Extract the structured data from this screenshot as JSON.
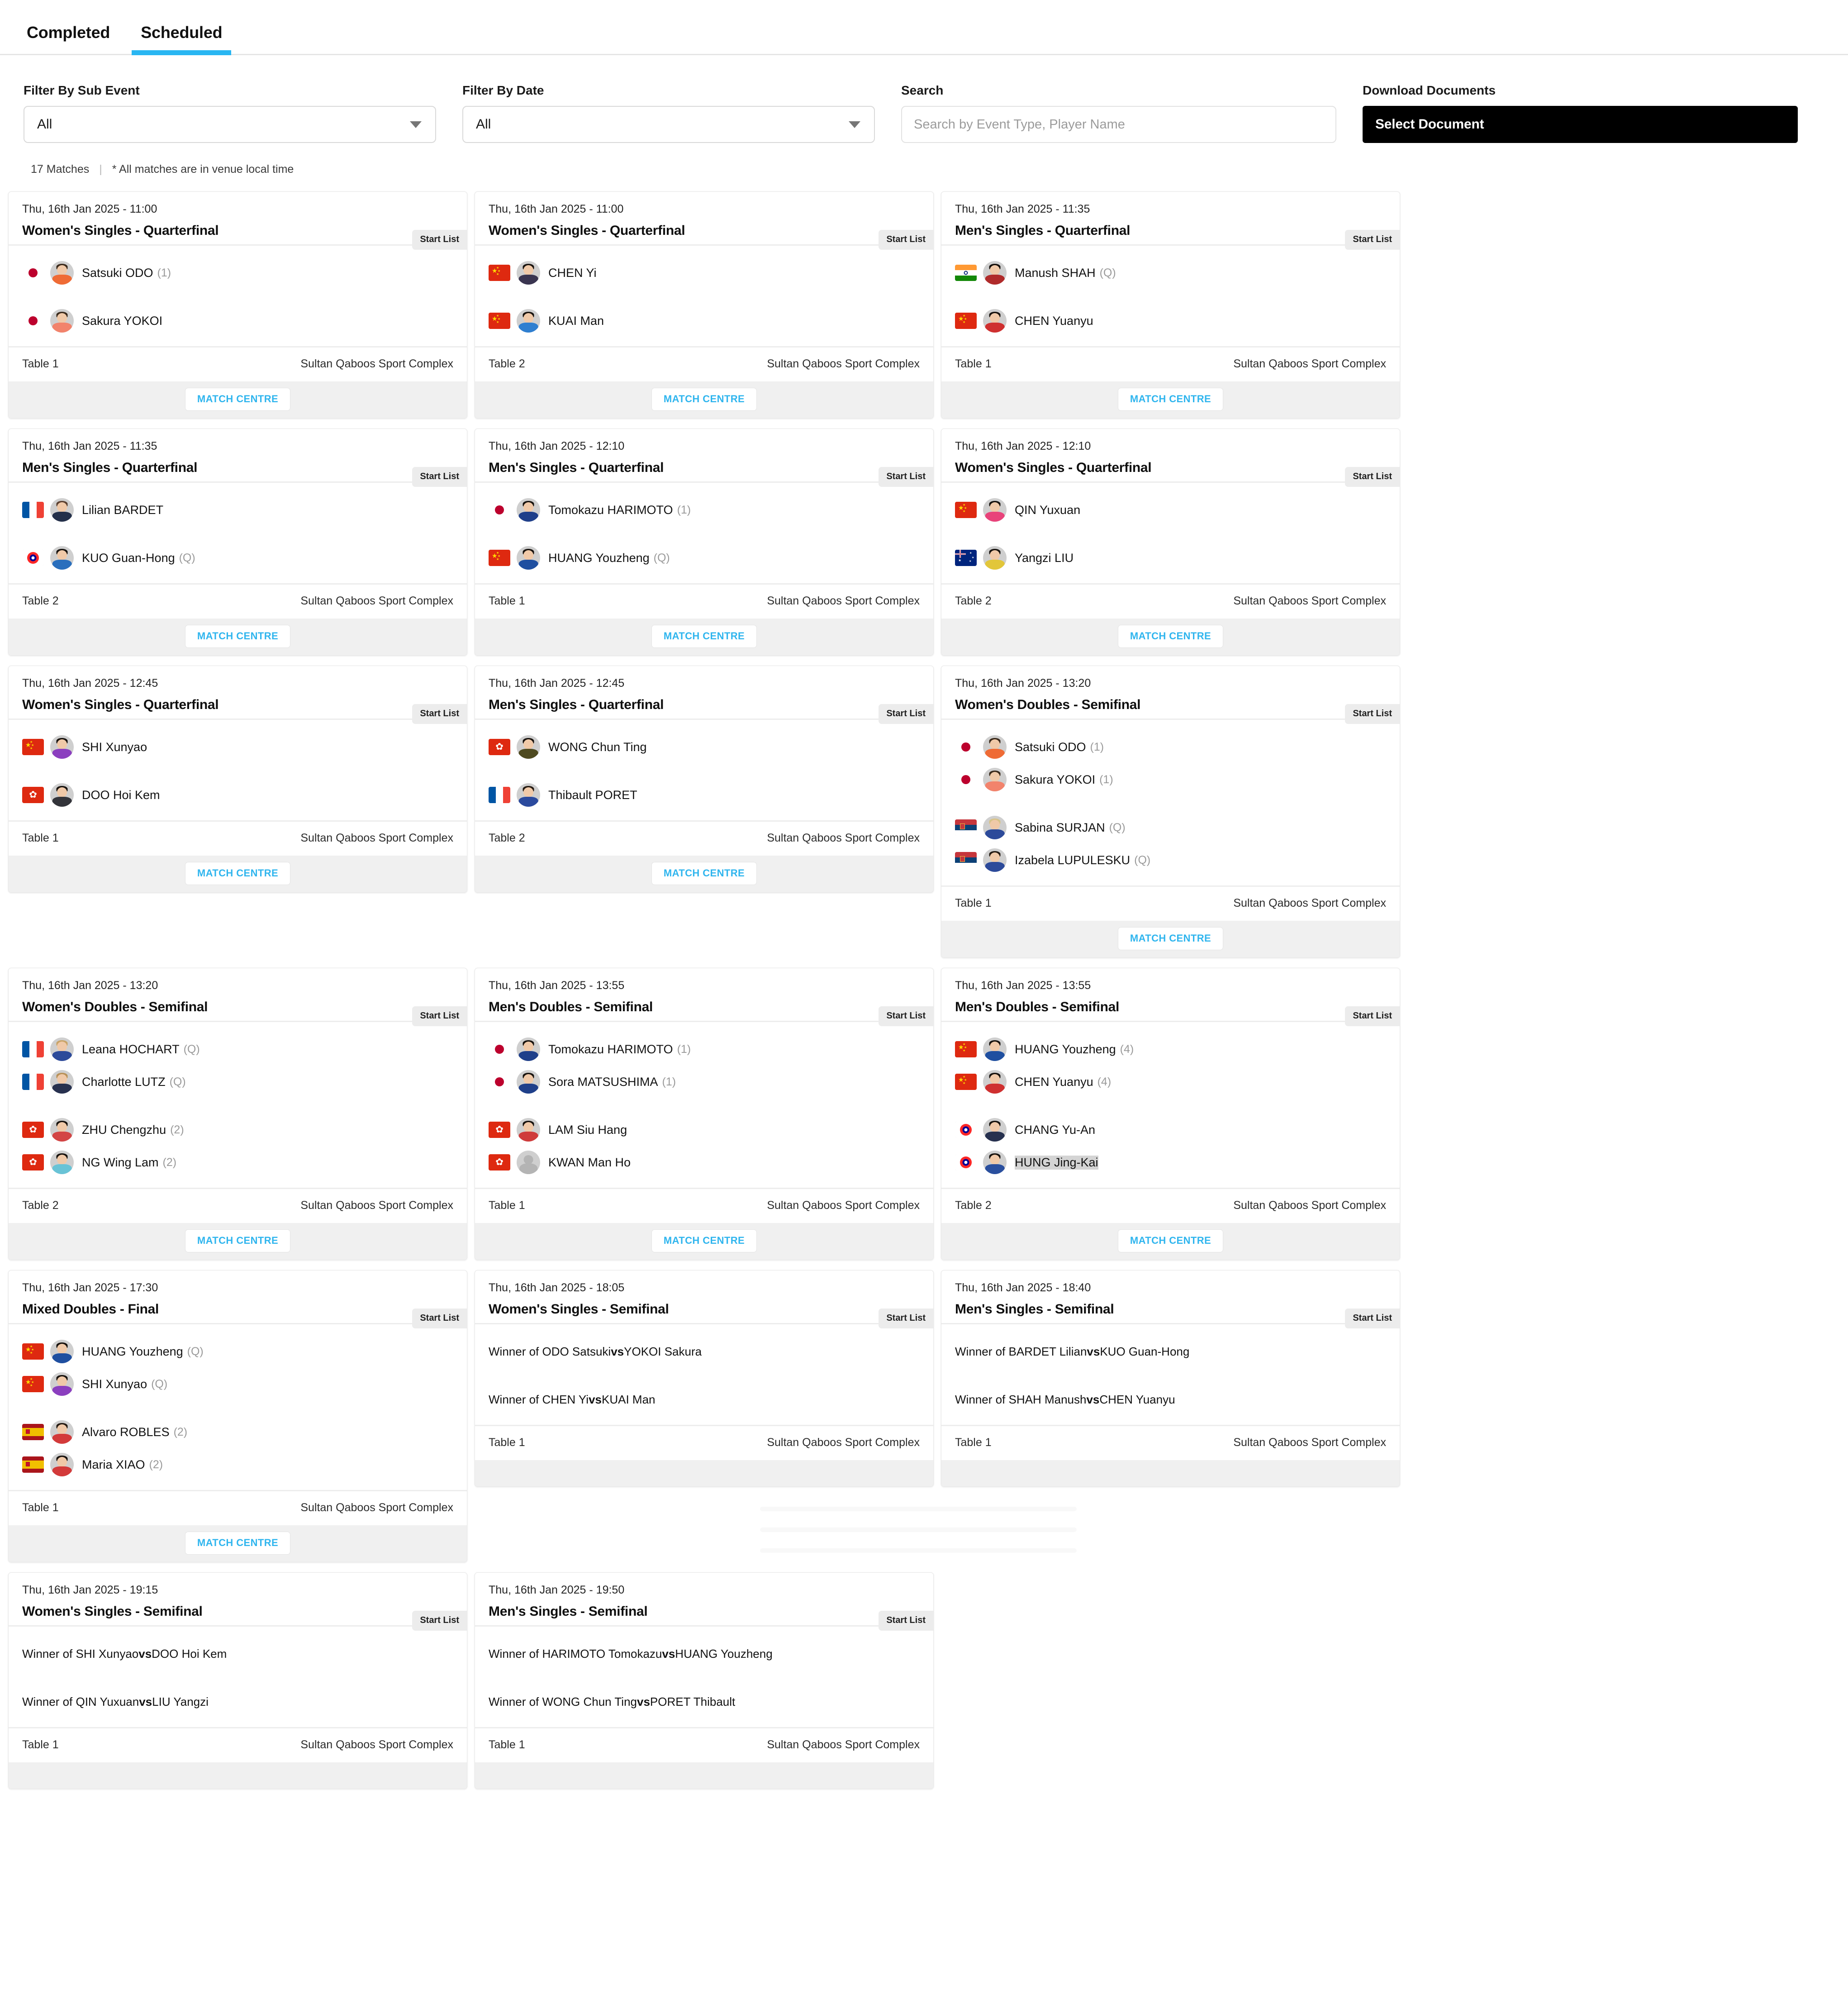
{
  "tabs": [
    {
      "label": "Completed",
      "active": false
    },
    {
      "label": "Scheduled",
      "active": true
    }
  ],
  "filters": {
    "sub_event": {
      "label": "Filter By Sub Event",
      "value": "All"
    },
    "date": {
      "label": "Filter By Date",
      "value": "All"
    },
    "search": {
      "label": "Search",
      "placeholder": "Search by Event Type, Player Name",
      "value": ""
    },
    "documents": {
      "label": "Download Documents",
      "button": "Select Document"
    }
  },
  "summary": {
    "count": "17 Matches",
    "separator": "|",
    "note": "* All matches are in venue local time"
  },
  "labels": {
    "start_list": "Start List",
    "match_centre": "MATCH CENTRE",
    "venue": "Sultan Qaboos Sport Complex"
  },
  "colors": {
    "accent": "#29b6f2",
    "match_centre_text": "#2fb5ee",
    "doc_button_bg": "#000000",
    "selection_highlight": "#d4d4d4"
  },
  "matches": [
    {
      "date": "Thu, 16th Jan 2025 - 11:00",
      "title": "Women's Singles - Quarterfinal",
      "table": "Table 1",
      "venue": "Sultan Qaboos Sport Complex",
      "has_match_centre": true,
      "teams": [
        {
          "players": [
            {
              "name": "Satsuki ODO",
              "seed": "(1)",
              "flag": "jp",
              "shirt": "#ef6b35",
              "hair": "#3a2a1c"
            }
          ]
        },
        {
          "players": [
            {
              "name": "Sakura YOKOI",
              "seed": "",
              "flag": "jp",
              "shirt": "#f2836c",
              "hair": "#3a2a1c"
            }
          ]
        }
      ]
    },
    {
      "date": "Thu, 16th Jan 2025 - 11:00",
      "title": "Women's Singles - Quarterfinal",
      "table": "Table 2",
      "venue": "Sultan Qaboos Sport Complex",
      "has_match_centre": true,
      "teams": [
        {
          "players": [
            {
              "name": "CHEN Yi",
              "seed": "",
              "flag": "cn",
              "shirt": "#3a3550",
              "hair": "#17120e"
            }
          ]
        },
        {
          "players": [
            {
              "name": "KUAI Man",
              "seed": "",
              "flag": "cn",
              "shirt": "#2f7fd0",
              "hair": "#17120e"
            }
          ]
        }
      ]
    },
    {
      "date": "Thu, 16th Jan 2025 - 11:35",
      "title": "Men's Singles - Quarterfinal",
      "table": "Table 1",
      "venue": "Sultan Qaboos Sport Complex",
      "has_match_centre": true,
      "teams": [
        {
          "players": [
            {
              "name": "Manush SHAH",
              "seed": "(Q)",
              "flag": "in",
              "shirt": "#b02b2b",
              "hair": "#140f0b"
            }
          ]
        },
        {
          "players": [
            {
              "name": "CHEN Yuanyu",
              "seed": "",
              "flag": "cn",
              "shirt": "#cf3030",
              "hair": "#17120e"
            }
          ]
        }
      ]
    },
    {
      "date": "Thu, 16th Jan 2025 - 11:35",
      "title": "Men's Singles - Quarterfinal",
      "table": "Table 2",
      "venue": "Sultan Qaboos Sport Complex",
      "has_match_centre": true,
      "teams": [
        {
          "players": [
            {
              "name": "Lilian BARDET",
              "seed": "",
              "flag": "fr",
              "shirt": "#24304a",
              "hair": "#5b4030"
            }
          ]
        },
        {
          "players": [
            {
              "name": "KUO Guan-Hong",
              "seed": "(Q)",
              "flag": "tw",
              "shirt": "#2a6fbd",
              "hair": "#17120e"
            }
          ]
        }
      ]
    },
    {
      "date": "Thu, 16th Jan 2025 - 12:10",
      "title": "Men's Singles - Quarterfinal",
      "table": "Table 1",
      "venue": "Sultan Qaboos Sport Complex",
      "has_match_centre": true,
      "teams": [
        {
          "players": [
            {
              "name": "Tomokazu HARIMOTO",
              "seed": "(1)",
              "flag": "jp",
              "shirt": "#1f3f8a",
              "hair": "#17120e"
            }
          ]
        },
        {
          "players": [
            {
              "name": "HUANG Youzheng",
              "seed": "(Q)",
              "flag": "cn",
              "shirt": "#1f4fa0",
              "hair": "#17120e"
            }
          ]
        }
      ]
    },
    {
      "date": "Thu, 16th Jan 2025 - 12:10",
      "title": "Women's Singles - Quarterfinal",
      "table": "Table 2",
      "venue": "Sultan Qaboos Sport Complex",
      "has_match_centre": true,
      "teams": [
        {
          "players": [
            {
              "name": "QIN Yuxuan",
              "seed": "",
              "flag": "cn",
              "shirt": "#e8437a",
              "hair": "#17120e"
            }
          ]
        },
        {
          "players": [
            {
              "name": "Yangzi LIU",
              "seed": "",
              "flag": "au",
              "shirt": "#e2c63a",
              "hair": "#17120e"
            }
          ]
        }
      ]
    },
    {
      "date": "Thu, 16th Jan 2025 - 12:45",
      "title": "Women's Singles - Quarterfinal",
      "table": "Table 1",
      "venue": "Sultan Qaboos Sport Complex",
      "has_match_centre": true,
      "teams": [
        {
          "players": [
            {
              "name": "SHI Xunyao",
              "seed": "",
              "flag": "cn",
              "shirt": "#8b3fbf",
              "hair": "#17120e"
            }
          ]
        },
        {
          "players": [
            {
              "name": "DOO Hoi Kem",
              "seed": "",
              "flag": "hk",
              "shirt": "#33343a",
              "hair": "#17120e"
            }
          ]
        }
      ]
    },
    {
      "date": "Thu, 16th Jan 2025 - 12:45",
      "title": "Men's Singles - Quarterfinal",
      "table": "Table 2",
      "venue": "Sultan Qaboos Sport Complex",
      "has_match_centre": true,
      "teams": [
        {
          "players": [
            {
              "name": "WONG Chun Ting",
              "seed": "",
              "flag": "hk",
              "shirt": "#4e4a20",
              "hair": "#17120e"
            }
          ]
        },
        {
          "players": [
            {
              "name": "Thibault PORET",
              "seed": "",
              "flag": "fr",
              "shirt": "#2b4a9e",
              "hair": "#241a12"
            }
          ]
        }
      ]
    },
    {
      "date": "Thu, 16th Jan 2025 - 13:20",
      "title": "Women's Doubles - Semifinal",
      "table": "Table 1",
      "venue": "Sultan Qaboos Sport Complex",
      "has_match_centre": true,
      "teams": [
        {
          "players": [
            {
              "name": "Satsuki ODO",
              "seed": "(1)",
              "flag": "jp",
              "shirt": "#ef6b35",
              "hair": "#3a2a1c"
            },
            {
              "name": "Sakura YOKOI",
              "seed": "(1)",
              "flag": "jp",
              "shirt": "#f2836c",
              "hair": "#3a2a1c"
            }
          ]
        },
        {
          "players": [
            {
              "name": "Sabina SURJAN",
              "seed": "(Q)",
              "flag": "rs",
              "shirt": "#2c4a9a",
              "hair": "#d8c38a"
            },
            {
              "name": "Izabela LUPULESKU",
              "seed": "(Q)",
              "flag": "rs",
              "shirt": "#2c4a9a",
              "hair": "#241a12"
            }
          ]
        }
      ]
    },
    {
      "date": "Thu, 16th Jan 2025 - 13:20",
      "title": "Women's Doubles - Semifinal",
      "table": "Table 2",
      "venue": "Sultan Qaboos Sport Complex",
      "has_match_centre": true,
      "teams": [
        {
          "players": [
            {
              "name": "Leana HOCHART",
              "seed": "(Q)",
              "flag": "fr",
              "shirt": "#2c4a9a",
              "hair": "#c9a468"
            },
            {
              "name": "Charlotte LUTZ",
              "seed": "(Q)",
              "flag": "fr",
              "shirt": "#27314f",
              "hair": "#b89158"
            }
          ]
        },
        {
          "players": [
            {
              "name": "ZHU Chengzhu",
              "seed": "(2)",
              "flag": "hk",
              "shirt": "#d34545",
              "hair": "#17120e"
            },
            {
              "name": "NG Wing Lam",
              "seed": "(2)",
              "flag": "hk",
              "shirt": "#69c3d6",
              "hair": "#17120e"
            }
          ]
        }
      ]
    },
    {
      "date": "Thu, 16th Jan 2025 - 13:55",
      "title": "Men's Doubles - Semifinal",
      "table": "Table 1",
      "venue": "Sultan Qaboos Sport Complex",
      "has_match_centre": true,
      "teams": [
        {
          "players": [
            {
              "name": "Tomokazu HARIMOTO",
              "seed": "(1)",
              "flag": "jp",
              "shirt": "#1f3f8a",
              "hair": "#17120e"
            },
            {
              "name": "Sora MATSUSHIMA",
              "seed": "(1)",
              "flag": "jp",
              "shirt": "#1f3f8a",
              "hair": "#17120e"
            }
          ]
        },
        {
          "players": [
            {
              "name": "LAM Siu Hang",
              "seed": "",
              "flag": "hk",
              "shirt": "#cf3b3b",
              "hair": "#17120e"
            },
            {
              "name": "KWAN Man Ho",
              "seed": "",
              "flag": "hk",
              "shirt": "",
              "hair": "",
              "silhouette": true
            }
          ]
        }
      ]
    },
    {
      "date": "Thu, 16th Jan 2025 - 13:55",
      "title": "Men's Doubles - Semifinal",
      "table": "Table 2",
      "venue": "Sultan Qaboos Sport Complex",
      "has_match_centre": true,
      "teams": [
        {
          "players": [
            {
              "name": "HUANG Youzheng",
              "seed": "(4)",
              "flag": "cn",
              "shirt": "#1f4fa0",
              "hair": "#17120e"
            },
            {
              "name": "CHEN Yuanyu",
              "seed": "(4)",
              "flag": "cn",
              "shirt": "#cf3030",
              "hair": "#17120e"
            }
          ]
        },
        {
          "players": [
            {
              "name": "CHANG Yu-An",
              "seed": "",
              "flag": "tw",
              "shirt": "#27314f",
              "hair": "#17120e"
            },
            {
              "name": "HUNG Jing-Kai",
              "seed": "",
              "flag": "tw",
              "shirt": "#2a4f9e",
              "hair": "#17120e",
              "selected": true
            }
          ]
        }
      ]
    },
    {
      "date": "Thu, 16th Jan 2025 - 17:30",
      "title": "Mixed Doubles - Final",
      "table": "Table 1",
      "venue": "Sultan Qaboos Sport Complex",
      "has_match_centre": true,
      "teams": [
        {
          "players": [
            {
              "name": "HUANG Youzheng",
              "seed": "(Q)",
              "flag": "cn",
              "shirt": "#1f4fa0",
              "hair": "#17120e"
            },
            {
              "name": "SHI Xunyao",
              "seed": "(Q)",
              "flag": "cn",
              "shirt": "#8b3fbf",
              "hair": "#17120e"
            }
          ]
        },
        {
          "players": [
            {
              "name": "Alvaro ROBLES",
              "seed": "(2)",
              "flag": "es",
              "shirt": "#d33a3a",
              "hair": "#241a12"
            },
            {
              "name": "Maria XIAO",
              "seed": "(2)",
              "flag": "es",
              "shirt": "#d33a3a",
              "hair": "#17120e"
            }
          ]
        }
      ]
    },
    {
      "date": "Thu, 16th Jan 2025 - 18:05",
      "title": "Women's Singles - Semifinal",
      "table": "Table 1",
      "venue": "Sultan Qaboos Sport Complex",
      "has_match_centre": false,
      "tbd": [
        {
          "prefix": "Winner of ODO Satsuki ",
          "vs": "vs",
          "suffix": " YOKOI Sakura"
        },
        {
          "prefix": "Winner of CHEN Yi ",
          "vs": "vs",
          "suffix": " KUAI Man"
        }
      ]
    },
    {
      "date": "Thu, 16th Jan 2025 - 18:40",
      "title": "Men's Singles - Semifinal",
      "table": "Table 1",
      "venue": "Sultan Qaboos Sport Complex",
      "has_match_centre": false,
      "tbd": [
        {
          "prefix": "Winner of BARDET Lilian ",
          "vs": "vs",
          "suffix": " KUO Guan-Hong"
        },
        {
          "prefix": "Winner of SHAH Manush ",
          "vs": "vs",
          "suffix": " CHEN Yuanyu"
        }
      ]
    },
    {
      "date": "Thu, 16th Jan 2025 - 19:15",
      "title": "Women's Singles - Semifinal",
      "table": "Table 1",
      "venue": "Sultan Qaboos Sport Complex",
      "has_match_centre": false,
      "tbd": [
        {
          "prefix": "Winner of SHI Xunyao ",
          "vs": "vs",
          "suffix": " DOO Hoi Kem"
        },
        {
          "prefix": "Winner of QIN Yuxuan ",
          "vs": "vs",
          "suffix": " LIU Yangzi"
        }
      ]
    },
    {
      "date": "Thu, 16th Jan 2025 - 19:50",
      "title": "Men's Singles - Semifinal",
      "table": "Table 1",
      "venue": "Sultan Qaboos Sport Complex",
      "has_match_centre": false,
      "tbd": [
        {
          "prefix": "Winner of HARIMOTO Tomokazu ",
          "vs": "vs",
          "suffix": " HUANG Youzheng"
        },
        {
          "prefix": "Winner of WONG Chun Ting ",
          "vs": "vs",
          "suffix": " PORET Thibault"
        }
      ]
    }
  ]
}
